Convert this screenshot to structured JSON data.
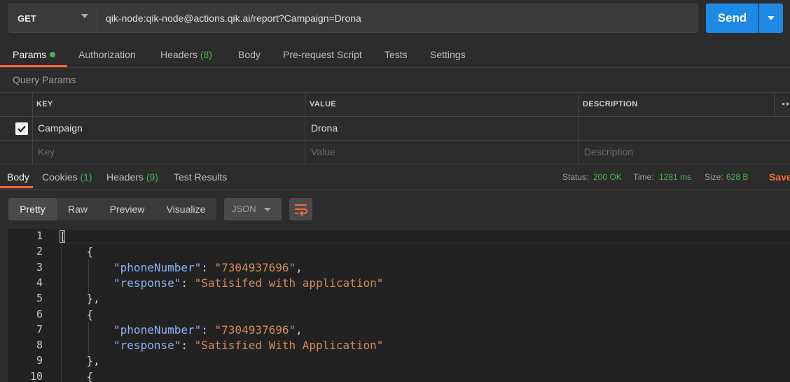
{
  "request": {
    "method": "GET",
    "url": "qik-node:qik-node@actions.qik.ai/report?Campaign=Drona",
    "send_label": "Send"
  },
  "request_tabs": {
    "params": "Params",
    "authorization": "Authorization",
    "headers": "Headers",
    "headers_count": "(8)",
    "body": "Body",
    "prerequest": "Pre-request Script",
    "tests": "Tests",
    "settings": "Settings"
  },
  "query_params": {
    "title": "Query Params",
    "columns": [
      "KEY",
      "VALUE",
      "DESCRIPTION"
    ],
    "rows": [
      {
        "checked": true,
        "key": "Campaign",
        "value": "Drona",
        "description": ""
      }
    ],
    "placeholders": {
      "key": "Key",
      "value": "Value",
      "description": "Description"
    }
  },
  "response_tabs": {
    "body": "Body",
    "cookies": "Cookies",
    "cookies_count": "(1)",
    "headers": "Headers",
    "headers_count": "(9)",
    "test_results": "Test Results"
  },
  "response_status": {
    "status_label": "Status:",
    "status_value": "200 OK",
    "time_label": "Time:",
    "time_value": "1281 ms",
    "size_label": "Size:",
    "size_value": "628 B",
    "save_label": "Save"
  },
  "body_toolbar": {
    "views": [
      "Pretty",
      "Raw",
      "Preview",
      "Visualize"
    ],
    "language": "JSON"
  },
  "editor": {
    "line_numbers": [
      "1",
      "2",
      "3",
      "4",
      "5",
      "6",
      "7",
      "8",
      "9",
      "10"
    ],
    "lines": [
      {
        "indent": 0,
        "text": "["
      },
      {
        "indent": 1,
        "text": "{"
      },
      {
        "indent": 2,
        "key": "\"phoneNumber\"",
        "value": "\"7304937696\"",
        "trail": ","
      },
      {
        "indent": 2,
        "key": "\"response\"",
        "value": "\"Satisifed with application\"",
        "trail": ""
      },
      {
        "indent": 1,
        "text": "},"
      },
      {
        "indent": 1,
        "text": "{"
      },
      {
        "indent": 2,
        "key": "\"phoneNumber\"",
        "value": "\"7304937696\"",
        "trail": ","
      },
      {
        "indent": 2,
        "key": "\"response\"",
        "value": "\"Satisfied With Application\"",
        "trail": ""
      },
      {
        "indent": 1,
        "text": "},"
      },
      {
        "indent": 1,
        "text": "{"
      }
    ]
  },
  "colors": {
    "accent": "#f26b3a",
    "send": "#1e88e5",
    "success": "#4caf50"
  }
}
